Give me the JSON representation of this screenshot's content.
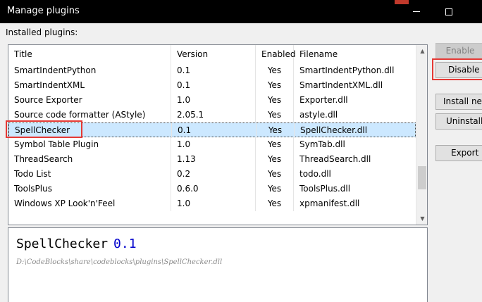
{
  "window": {
    "title": "Manage plugins",
    "minimize_icon": "minimize-icon",
    "maximize_icon": "maximize-icon"
  },
  "installed_label": "Installed plugins:",
  "columns": [
    "Title",
    "Version",
    "Enabled",
    "Filename"
  ],
  "plugins": [
    {
      "title": "SmartIndentPython",
      "version": "0.1",
      "enabled": "Yes",
      "filename": "SmartIndentPython.dll"
    },
    {
      "title": "SmartIndentXML",
      "version": "0.1",
      "enabled": "Yes",
      "filename": "SmartIndentXML.dll"
    },
    {
      "title": "Source Exporter",
      "version": "1.0",
      "enabled": "Yes",
      "filename": "Exporter.dll"
    },
    {
      "title": "Source code formatter (AStyle)",
      "version": "2.05.1",
      "enabled": "Yes",
      "filename": "astyle.dll"
    },
    {
      "title": "SpellChecker",
      "version": "0.1",
      "enabled": "Yes",
      "filename": "SpellChecker.dll",
      "selected": true
    },
    {
      "title": "Symbol Table Plugin",
      "version": "1.0",
      "enabled": "Yes",
      "filename": "SymTab.dll"
    },
    {
      "title": "ThreadSearch",
      "version": "1.13",
      "enabled": "Yes",
      "filename": "ThreadSearch.dll"
    },
    {
      "title": "Todo List",
      "version": "0.2",
      "enabled": "Yes",
      "filename": "todo.dll"
    },
    {
      "title": "ToolsPlus",
      "version": "0.6.0",
      "enabled": "Yes",
      "filename": "ToolsPlus.dll"
    },
    {
      "title": "Windows XP Look'n'Feel",
      "version": "1.0",
      "enabled": "Yes",
      "filename": "xpmanifest.dll"
    }
  ],
  "buttons": {
    "enable": "Enable",
    "disable": "Disable",
    "install": "Install new",
    "uninstall": "Uninstall",
    "export": "Export"
  },
  "info": {
    "name": "SpellChecker",
    "version": "0.1",
    "path": "D:\\CodeBlocks\\share\\codeblocks\\plugins\\SpellChecker.dll"
  },
  "colors": {
    "selection": "#cce8ff",
    "highlight": "#e53935",
    "version_text": "#0000cc"
  }
}
